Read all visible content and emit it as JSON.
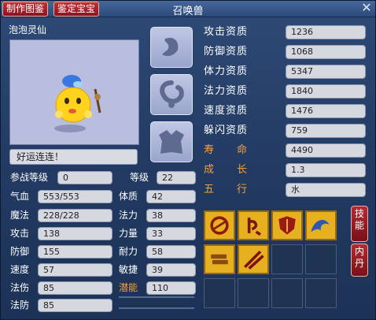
{
  "window": {
    "title": "召唤兽",
    "tab_atlas": "制作图鉴",
    "tab_appraise": "鉴定宝宝",
    "close": "✕"
  },
  "pet": {
    "name": "泡泡灵仙",
    "motto": "好运连连！",
    "portrait": "bubble-spirit-pet"
  },
  "stats": {
    "battle_level_label": "参战等级",
    "battle_level": "0",
    "level_label": "等级",
    "level": "22",
    "hp_label": "气血",
    "hp": "553/553",
    "mp_label": "魔法",
    "mp": "228/228",
    "atk_label": "攻击",
    "atk": "138",
    "def_label": "防御",
    "def": "155",
    "spd_label": "速度",
    "spd": "57",
    "mdmg_label": "法伤",
    "mdmg": "85",
    "mdef_label": "法防",
    "mdef": "85",
    "con_label": "体质",
    "con": "42",
    "mag_label": "法力",
    "mag": "38",
    "str_label": "力量",
    "str": "33",
    "end_label": "耐力",
    "end": "58",
    "agi_label": "敏捷",
    "agi": "39",
    "pot_label": "潜能",
    "pot": "110"
  },
  "aptitudes": [
    {
      "label": "攻击资质",
      "value": "1236"
    },
    {
      "label": "防御资质",
      "value": "1068"
    },
    {
      "label": "体力资质",
      "value": "5347"
    },
    {
      "label": "法力资质",
      "value": "1840"
    },
    {
      "label": "速度资质",
      "value": "1476"
    },
    {
      "label": "躲闪资质",
      "value": "759"
    },
    {
      "label": "寿　　命",
      "value": "4490"
    },
    {
      "label": "成　　长",
      "value": "1.3"
    },
    {
      "label": "五　　行",
      "value": "水"
    }
  ],
  "equip_slots": [
    "helmet-slot-icon",
    "collar-slot-icon",
    "armor-slot-icon"
  ],
  "skills": [
    "skill-roar-icon",
    "skill-rune-icon",
    "skill-shield-icon",
    "skill-wave-icon",
    "skill-scroll-icon",
    "skill-strike-icon"
  ],
  "side_buttons": {
    "skills": "技能",
    "inner_pill": "内丹"
  },
  "colors": {
    "title_bar": "#2c4a7a",
    "accent_gold": "#f0a23a",
    "button_red": "#b42a34",
    "skill_gold": "#e6b020"
  }
}
